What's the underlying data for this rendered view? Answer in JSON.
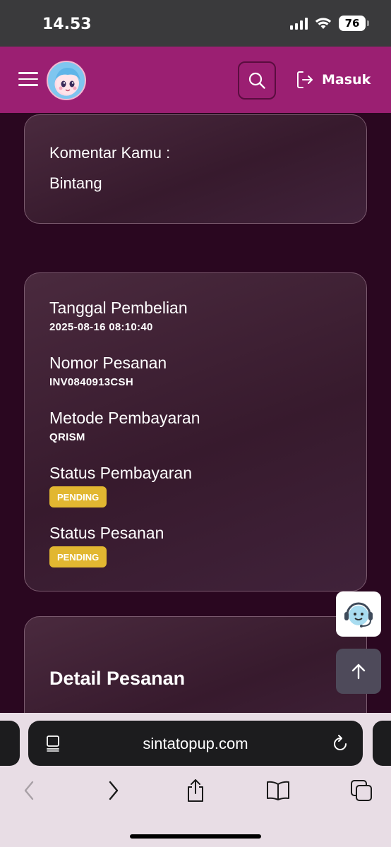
{
  "status_bar": {
    "time": "14.53",
    "battery": "76"
  },
  "header": {
    "login_label": "Masuk"
  },
  "comment": {
    "label": "Komentar Kamu :",
    "value": "Bintang"
  },
  "order_info": {
    "purchase_date_label": "Tanggal Pembelian",
    "purchase_date_value": "2025-08-16 08:10:40",
    "order_number_label": "Nomor Pesanan",
    "order_number_value": "INV0840913CSH",
    "payment_method_label": "Metode Pembayaran",
    "payment_method_value": "QRISM",
    "payment_status_label": "Status Pembayaran",
    "payment_status_value": "PENDING",
    "order_status_label": "Status Pesanan",
    "order_status_value": "PENDING"
  },
  "details": {
    "title": "Detail Pesanan"
  },
  "browser": {
    "url": "sintatopup.com"
  },
  "colors": {
    "header": "#9b1f72",
    "background": "#2a0720",
    "badge": "#e2b731"
  }
}
